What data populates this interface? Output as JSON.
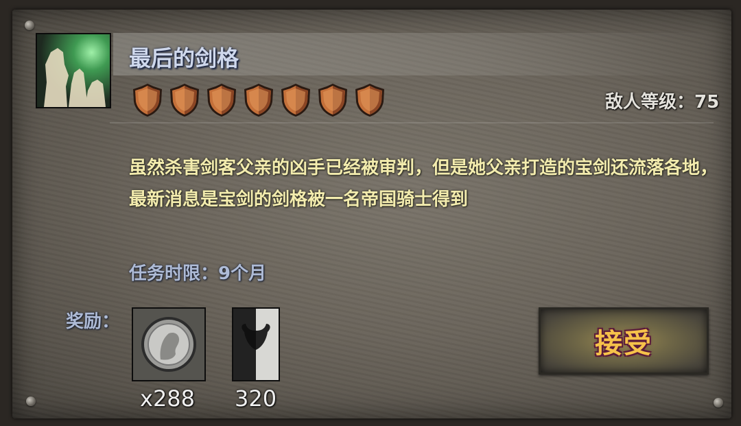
{
  "quest": {
    "title": "最后的剑格",
    "difficulty_shields": 7,
    "enemy_level_text": "敌人等级：75",
    "description": "虽然杀害剑客父亲的凶手已经被审判，但是她父亲打造的宝剑还流落各地，最新消息是宝剑的剑格被一名帝国骑士得到",
    "time_limit_text": "任务时限：9个月",
    "rewards_label": "奖励：",
    "rewards": [
      {
        "icon": "silver-coin-icon",
        "count": "x288"
      },
      {
        "icon": "bull-banner-icon",
        "count": "320"
      }
    ],
    "accept_label": "接受"
  },
  "colors": {
    "title": "#cfd8ec",
    "description": "#f3ecae",
    "label_blue": "#aebbd6",
    "accept_text": "#f6c24a",
    "shield": "#c4703a"
  },
  "icons": {
    "portrait": "party-silhouette-icon",
    "shield": "bronze-shield-icon"
  }
}
